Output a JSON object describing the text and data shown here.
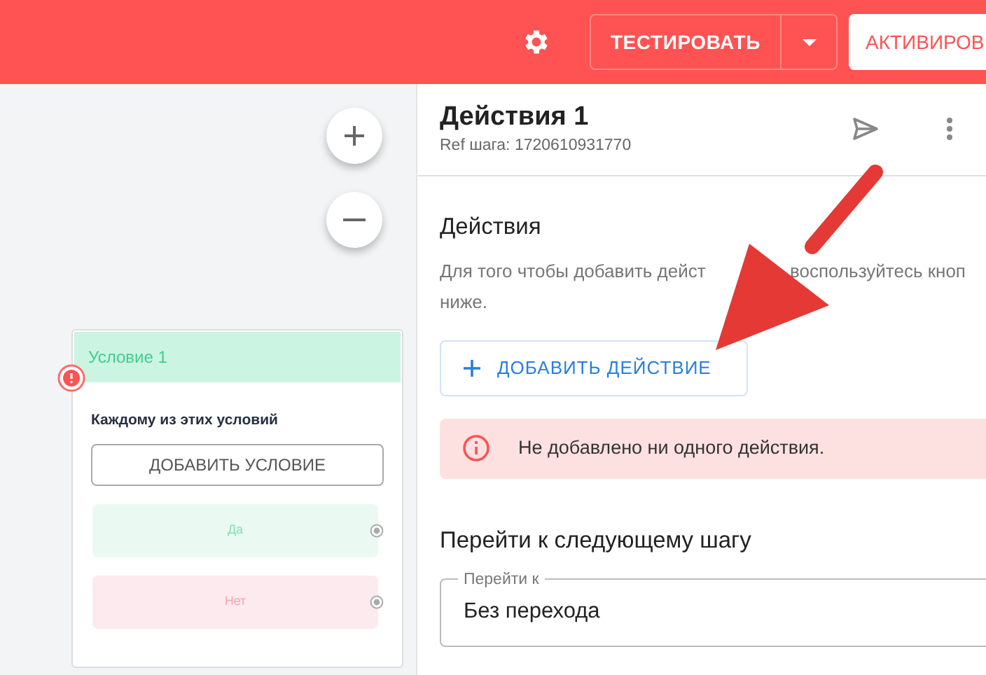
{
  "top_bar": {
    "test_button": "ТЕСТИРОВАТЬ",
    "activate_button": "АКТИВИРОВ"
  },
  "canvas": {
    "condition_node": {
      "title": "Условие 1",
      "error": true,
      "rule_label": "Каждому из этих условий",
      "add_button": "ДОБАВИТЬ УСЛОВИЕ",
      "outputs": [
        {
          "label": "Да",
          "kind": "yes"
        },
        {
          "label": "Нет",
          "kind": "no"
        }
      ]
    }
  },
  "panel": {
    "title": "Действия 1",
    "ref": "Ref шага: 1720610931770",
    "actions_section": {
      "heading": "Действия",
      "hint_lines": [
        [
          "Для того чтобы добавить дейст",
          "воспользуйтесь кноп"
        ],
        [
          "ниже."
        ]
      ],
      "add_button": "ДОБАВИТЬ ДЕЙСТВИЕ",
      "alert": "Не добавлено ни одного действия."
    },
    "next_step": {
      "heading": "Перейти к следующему шагу",
      "field": {
        "label": "Перейти к",
        "value": "Без перехода"
      }
    }
  }
}
